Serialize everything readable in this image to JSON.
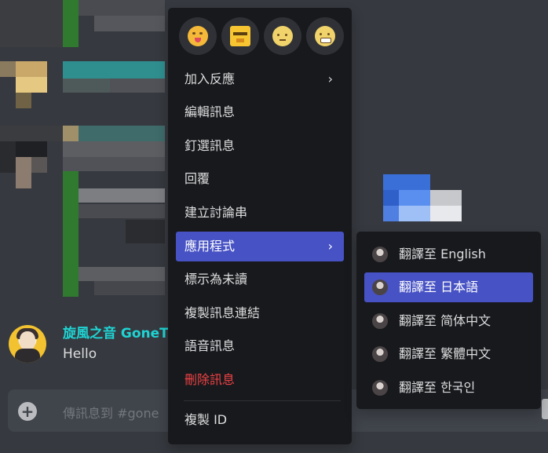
{
  "chat": {
    "author": "旋風之音 GoneT",
    "message": "Hello",
    "composer_placeholder": "傳訊息到 #gone",
    "plus_glyph": "+"
  },
  "context_menu": {
    "reactions": [
      {
        "icon": "yummy-face-emoji-icon",
        "color": "#f5b93a"
      },
      {
        "icon": "face-block-emoji-icon",
        "color": "#f7c531"
      },
      {
        "icon": "pensive-face-emoji-icon",
        "color": "#f0d36a"
      },
      {
        "icon": "grimace-face-emoji-icon",
        "color": "#f0d36a"
      }
    ],
    "items": [
      {
        "label": "加入反應",
        "submenu": true
      },
      {
        "label": "編輯訊息"
      },
      {
        "label": "釘選訊息"
      },
      {
        "label": "回覆"
      },
      {
        "label": "建立討論串"
      },
      {
        "label": "應用程式",
        "submenu": true,
        "active": true
      },
      {
        "label": "標示為未讀"
      },
      {
        "label": "複製訊息連結"
      },
      {
        "label": "語音訊息"
      },
      {
        "label": "刪除訊息",
        "danger": true
      },
      {
        "label": "複製 ID"
      }
    ],
    "chevron": "›"
  },
  "apps_submenu": {
    "items": [
      {
        "label": "翻譯至 English"
      },
      {
        "label": "翻譯至 日本語",
        "active": true
      },
      {
        "label": "翻譯至 简体中文"
      },
      {
        "label": "翻譯至 繁體中文"
      },
      {
        "label": "翻譯至 한국인"
      }
    ]
  },
  "colors": {
    "accent": "#4752c4",
    "menu_bg": "#18191c",
    "danger": "#ed4245",
    "author": "#1fd4d4"
  }
}
